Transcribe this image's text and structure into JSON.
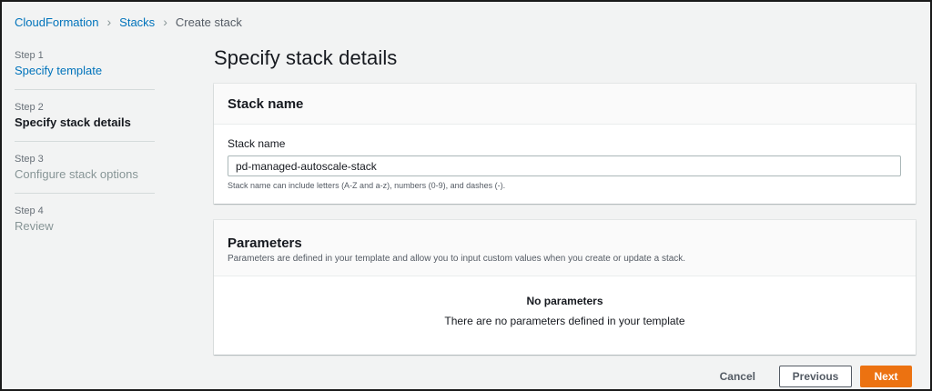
{
  "breadcrumb": {
    "items": [
      "CloudFormation",
      "Stacks",
      "Create stack"
    ]
  },
  "steps": [
    {
      "num": "Step 1",
      "label": "Specify template",
      "state": "link"
    },
    {
      "num": "Step 2",
      "label": "Specify stack details",
      "state": "active"
    },
    {
      "num": "Step 3",
      "label": "Configure stack options",
      "state": "disabled"
    },
    {
      "num": "Step 4",
      "label": "Review",
      "state": "disabled"
    }
  ],
  "page": {
    "title": "Specify stack details"
  },
  "stack_name_panel": {
    "title": "Stack name",
    "field_label": "Stack name",
    "value": "pd-managed-autoscale-stack",
    "hint": "Stack name can include letters (A-Z and a-z), numbers (0-9), and dashes (-)."
  },
  "parameters_panel": {
    "title": "Parameters",
    "description": "Parameters are defined in your template and allow you to input custom values when you create or update a stack.",
    "empty_title": "No parameters",
    "empty_description": "There are no parameters defined in your template"
  },
  "actions": {
    "cancel": "Cancel",
    "previous": "Previous",
    "next": "Next"
  },
  "colors": {
    "link": "#0073bb",
    "primary": "#ec7211",
    "background": "#f2f3f3"
  }
}
